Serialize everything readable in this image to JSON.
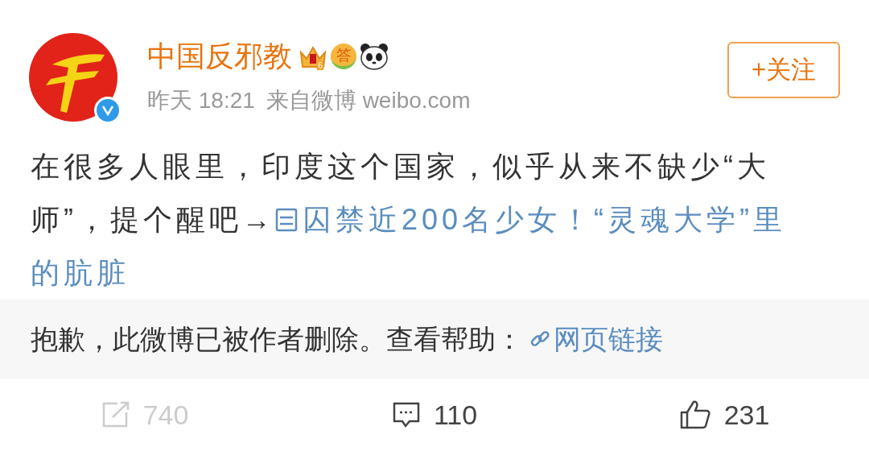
{
  "post": {
    "author": "中国反邪教",
    "verified": true,
    "badges": [
      {
        "kind": "vip",
        "text": "6"
      },
      {
        "kind": "answer",
        "text": "答"
      },
      {
        "kind": "panda"
      }
    ],
    "time": "昨天 18:21",
    "source": "来自微博 weibo.com",
    "follow_button": "+关注",
    "body": [
      {
        "kind": "text",
        "text": "在很多人眼里，印度这个国家，似乎从来不缺少“大师”，提个醒吧→"
      },
      {
        "kind": "link",
        "text": "囚禁近200名少女！“灵魂大学”里"
      },
      {
        "kind": "link",
        "text": "的肮脏"
      }
    ],
    "notice": {
      "text": "抱歉，此微博已被作者删除。查看帮助：",
      "link": "网页链接"
    },
    "actions": [
      {
        "kind": "repost",
        "count": "740",
        "disabled": true
      },
      {
        "kind": "comment",
        "count": "110",
        "disabled": false
      },
      {
        "kind": "like",
        "count": "231",
        "disabled": false
      }
    ]
  }
}
